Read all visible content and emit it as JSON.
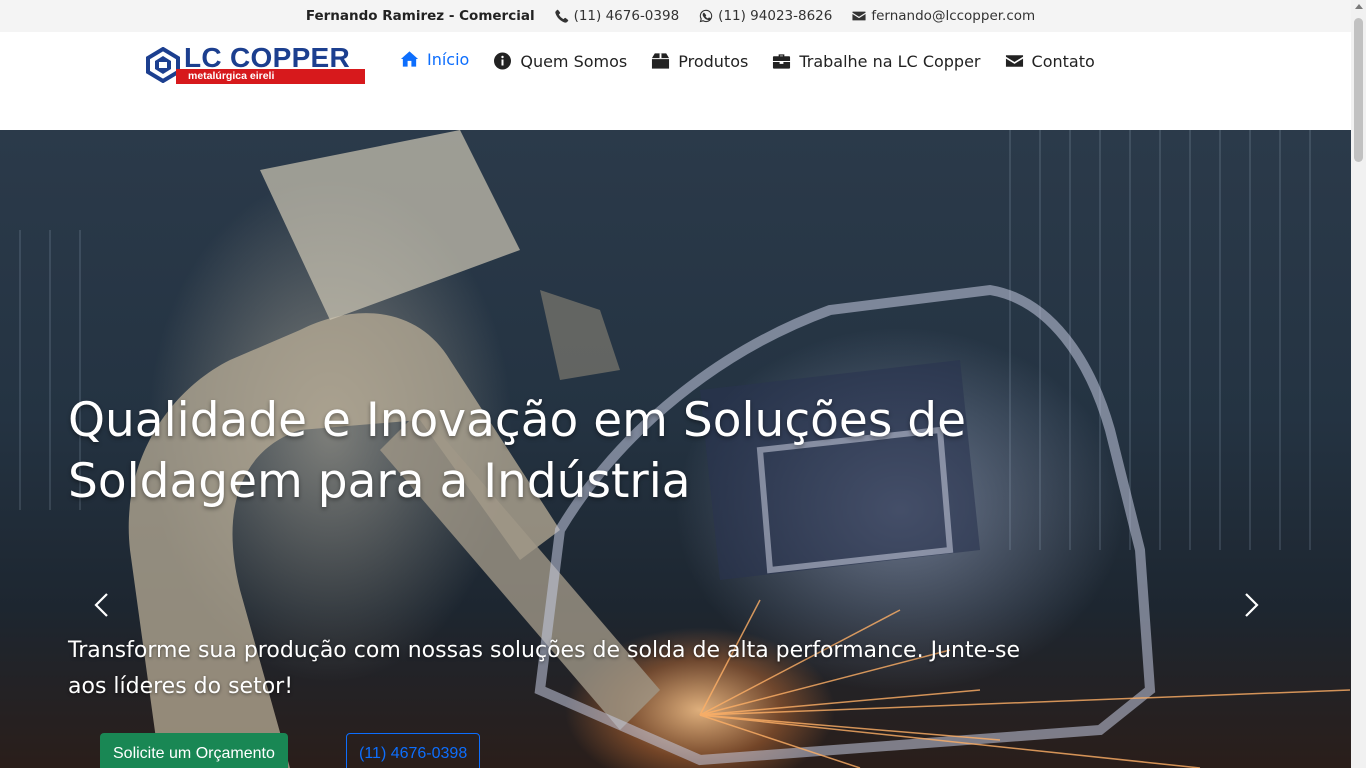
{
  "topbar": {
    "contact_name": "Fernando Ramirez - Comercial",
    "phone": "(11) 4676-0398",
    "whatsapp": "(11) 94023-8626",
    "email": "fernando@lccopper.com",
    "icons": [
      "phone-icon",
      "whatsapp-icon",
      "envelope-icon"
    ]
  },
  "logo": {
    "brand": "LC COPPER",
    "tagline": "metalúrgica eireli",
    "colors": {
      "brand_blue": "#1c3f8f",
      "tagline_red": "#d7191c"
    }
  },
  "nav": {
    "items": [
      {
        "label": "Início",
        "icon": "home-icon",
        "active": true
      },
      {
        "label": "Quem Somos",
        "icon": "info-circle-icon",
        "active": false
      },
      {
        "label": "Produtos",
        "icon": "box-icon",
        "active": false
      },
      {
        "label": "Trabalhe na LC Copper",
        "icon": "briefcase-icon",
        "active": false
      },
      {
        "label": "Contato",
        "icon": "envelope-icon",
        "active": false
      }
    ],
    "active_color": "#0d6efd"
  },
  "hero": {
    "title": "Qualidade e Inovação em Soluções de Soldagem para a Indústria",
    "subtitle": "Transforme sua produção com nossas soluções de solda de alta performance. Junte-se aos líderes do setor!",
    "primary_button": "Solicite um Orçamento",
    "secondary_button": "(11) 4676-0398",
    "prev_icon": "chevron-left-icon",
    "next_icon": "chevron-right-icon",
    "primary_color": "#198754",
    "secondary_color": "#0d6efd"
  }
}
